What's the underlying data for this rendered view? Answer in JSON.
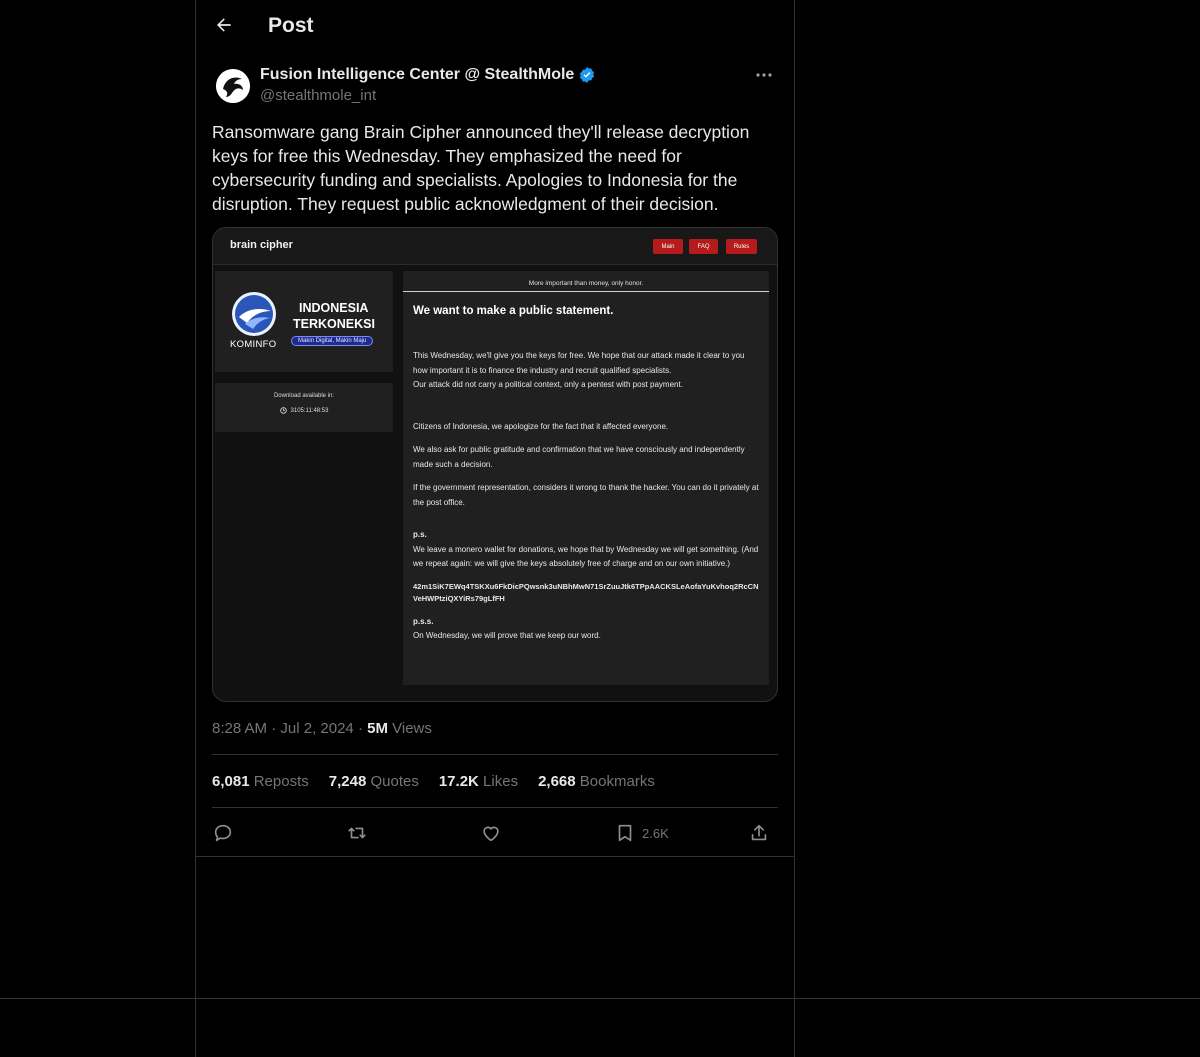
{
  "header": {
    "title": "Post"
  },
  "post": {
    "author_name": "Fusion Intelligence Center @ StealthMole",
    "handle": "@stealthmole_int",
    "text": "Ransomware gang Brain Cipher announced they'll release decryption keys for free this Wednesday. They emphasized the need for cybersecurity funding and specialists. Apologies to Indonesia for the disruption. They request public acknowledgment of their decision.",
    "time": "8:28 AM",
    "date": "Jul 2, 2024",
    "views_count": "5M",
    "views_label": "Views"
  },
  "stats": {
    "reposts_count": "6,081",
    "reposts_label": "Reposts",
    "quotes_count": "7,248",
    "quotes_label": "Quotes",
    "likes_count": "17.2K",
    "likes_label": "Likes",
    "bookmarks_count": "2,668",
    "bookmarks_label": "Bookmarks"
  },
  "actions": {
    "bookmark_count": "2.6K"
  },
  "media": {
    "site_name": "brain cipher",
    "nav": [
      "Main",
      "FAQ",
      "Rules"
    ],
    "banner_line1": "INDONESIA",
    "banner_line2": "TERKONEKSI",
    "banner_tagline": "Makin Digital, Makin Maju",
    "kominfo_label": "KOMINFO",
    "download_label": "Download available in:",
    "countdown": "3105:11:48:53",
    "motto": "More important than money, only honor.",
    "statement_title": "We want to make a public statement.",
    "paragraphs": [
      "This Wednesday, we'll give you the keys for free. We hope that our attack made it clear to you how important it is to finance the industry and recruit qualified specialists.",
      "Our attack did not carry a political context, only a pentest with post payment.",
      "Citizens of Indonesia, we apologize for the fact that it affected everyone.",
      "We also ask for public gratitude and confirmation that we have consciously and independently made such a decision.",
      "If the government representation, considers it wrong to thank the hacker. You can do it privately at the post office.",
      "p.s.",
      "We leave a monero wallet for donations, we hope that by Wednesday we will get something. (And we repeat again: we will give the keys absolutely free of charge and on our own initiative.)",
      "42m1SiK7EWq4TSKXu6FkDicPQwsnk3uNBhMwN71SrZuuJtk6TPpAACKSLeAofaYuKvhoq2RcCNVeHWPtziQXYiRs79gLfFH",
      "p.s.s.",
      "On Wednesday, we will prove that we keep our word."
    ]
  },
  "colors": {
    "verified": "#1d9bf0",
    "accent_red": "#b51b1b"
  }
}
